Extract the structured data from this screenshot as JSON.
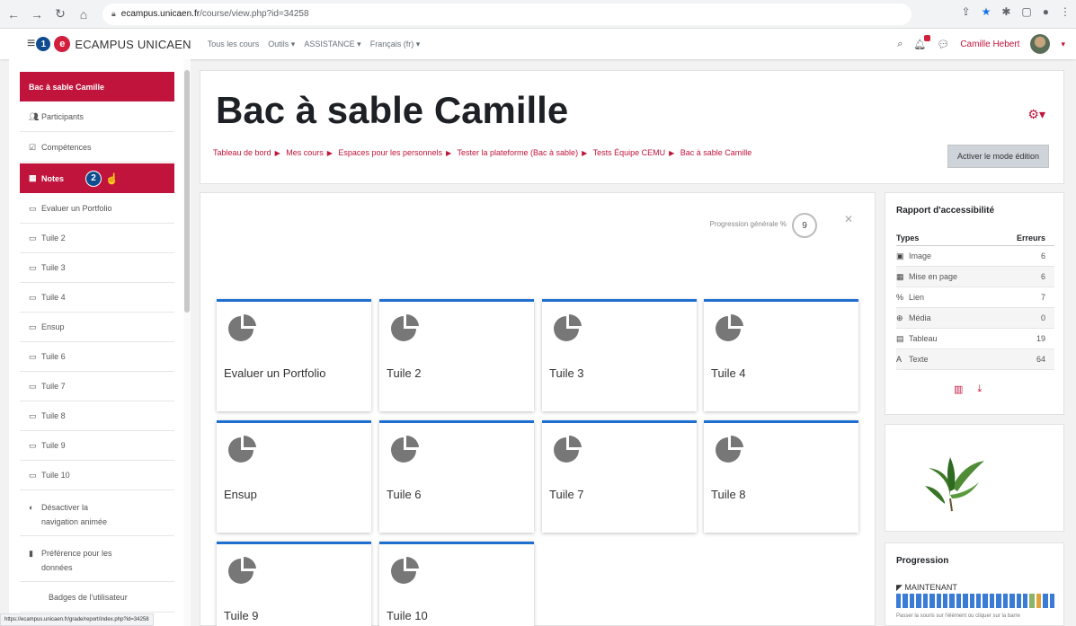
{
  "browser": {
    "url_host": "ecampus.unicaen.fr",
    "url_path": "/course/view.php?id=34258"
  },
  "navbar": {
    "step_badge": "1",
    "site_name": "ECAMPUS UNICAEN",
    "menu": [
      "Tous les cours",
      "Outils ▾",
      "ASSISTANCE ▾",
      "Français (fr) ▾"
    ],
    "user_name": "Camille Hebert"
  },
  "drawer": {
    "course_item": "Bac à sable Camille",
    "items": [
      {
        "label": "Participants",
        "icon": "users-icon"
      },
      {
        "label": "Compétences",
        "icon": "check-square-icon"
      },
      {
        "label": "Notes",
        "icon": "table-icon"
      },
      {
        "label": "Evaluer un Portfolio",
        "icon": "folder-icon"
      },
      {
        "label": "Tuile 2",
        "icon": "folder-icon"
      },
      {
        "label": "Tuile 3",
        "icon": "folder-icon"
      },
      {
        "label": "Tuile 4",
        "icon": "folder-icon"
      },
      {
        "label": "Ensup",
        "icon": "folder-icon"
      },
      {
        "label": "Tuile 6",
        "icon": "folder-icon"
      },
      {
        "label": "Tuile 7",
        "icon": "folder-icon"
      },
      {
        "label": "Tuile 8",
        "icon": "folder-icon"
      },
      {
        "label": "Tuile 9",
        "icon": "folder-icon"
      },
      {
        "label": "Tuile 10",
        "icon": "folder-icon"
      }
    ],
    "notes_badge": "2",
    "toggle_nav_line1": "Désactiver la",
    "toggle_nav_line2": "navigation animée",
    "data_pref_line1": "Préférence pour les",
    "data_pref_line2": "données",
    "badges": "Badges de l'utilisateur"
  },
  "header": {
    "title": "Bac à sable Camille",
    "breadcrumb": [
      "Tableau de bord",
      "Mes cours",
      "Espaces pour les personnels",
      "Tester la plateforme (Bac à sable)",
      "Tests Équipe CEMU",
      "Bac à sable Camille"
    ],
    "edit_button": "Activer le mode édition"
  },
  "main": {
    "progress_label": "Progression générale %",
    "progress_value": "9",
    "tiles": [
      "Evaluer un Portfolio",
      "Tuile 2",
      "Tuile 3",
      "Tuile 4",
      "Ensup",
      "Tuile 6",
      "Tuile 7",
      "Tuile 8",
      "Tuile 9",
      "Tuile 10"
    ]
  },
  "accessibility": {
    "title": "Rapport d'accessibilité",
    "col_types": "Types",
    "col_errors": "Erreurs",
    "rows": [
      {
        "icon": "image-icon",
        "glyph": "▣",
        "type": "Image",
        "errors": "6"
      },
      {
        "icon": "layout-icon",
        "glyph": "▦",
        "type": "Mise en page",
        "errors": "6"
      },
      {
        "icon": "link-icon",
        "glyph": "%",
        "type": "Lien",
        "errors": "7"
      },
      {
        "icon": "media-icon",
        "glyph": "⊕",
        "type": "Média",
        "errors": "0"
      },
      {
        "icon": "table-icon",
        "glyph": "▤",
        "type": "Tableau",
        "errors": "19"
      },
      {
        "icon": "text-icon",
        "glyph": "A",
        "type": "Texte",
        "errors": "64"
      }
    ]
  },
  "progression": {
    "title": "Progression",
    "now_label": "MAINTENANT",
    "hint": "Passer la souris sur l'élément ou cliquer sur la barre"
  },
  "status_url": "https://ecampus.unicaen.fr/grade/report/index.php?id=34258",
  "colors": {
    "brand": "#c0143c",
    "tile_accent": "#1f6fd1",
    "badge": "#0f4c8f"
  }
}
